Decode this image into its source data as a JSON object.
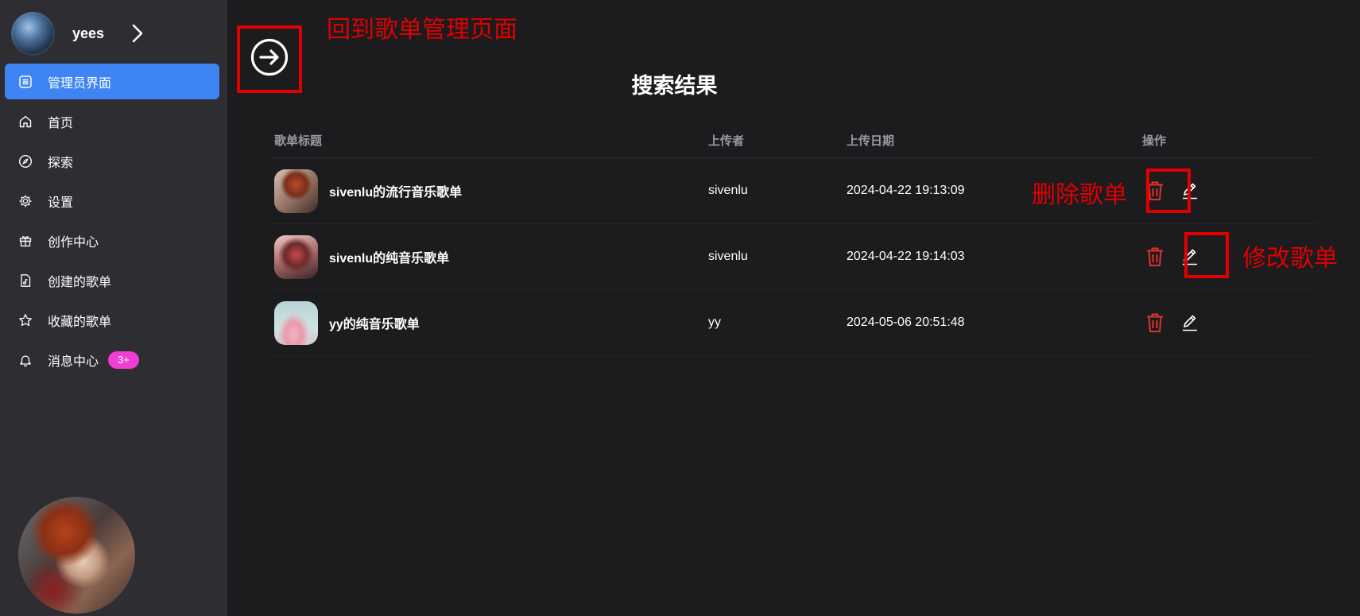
{
  "user": {
    "name": "yees"
  },
  "sidebar": {
    "items": [
      {
        "label": "管理员界面",
        "icon": "list-icon",
        "active": true
      },
      {
        "label": "首页",
        "icon": "home-icon"
      },
      {
        "label": "探索",
        "icon": "compass-icon"
      },
      {
        "label": "设置",
        "icon": "gear-icon"
      },
      {
        "label": "创作中心",
        "icon": "gift-icon"
      },
      {
        "label": "创建的歌单",
        "icon": "music-file-icon"
      },
      {
        "label": "收藏的歌单",
        "icon": "star-icon"
      },
      {
        "label": "消息中心",
        "icon": "bell-icon",
        "badge": "3+"
      }
    ]
  },
  "main": {
    "title": "搜索结果",
    "columns": [
      "歌单标题",
      "上传者",
      "上传日期",
      "操作"
    ],
    "rows": [
      {
        "title": "sivenlu的流行音乐歌单",
        "uploader": "sivenlu",
        "date": "2024-04-22 19:13:09"
      },
      {
        "title": "sivenlu的纯音乐歌单",
        "uploader": "sivenlu",
        "date": "2024-04-22 19:14:03"
      },
      {
        "title": "yy的纯音乐歌单",
        "uploader": "yy",
        "date": "2024-05-06 20:51:48"
      }
    ]
  },
  "annotations": {
    "back": "回到歌单管理页面",
    "delete": "删除歌单",
    "edit": "修改歌单"
  },
  "colors": {
    "accent": "#3e85f3",
    "danger": "#e0322b",
    "annotation": "#e00000",
    "badge": "#ef3fd3"
  }
}
